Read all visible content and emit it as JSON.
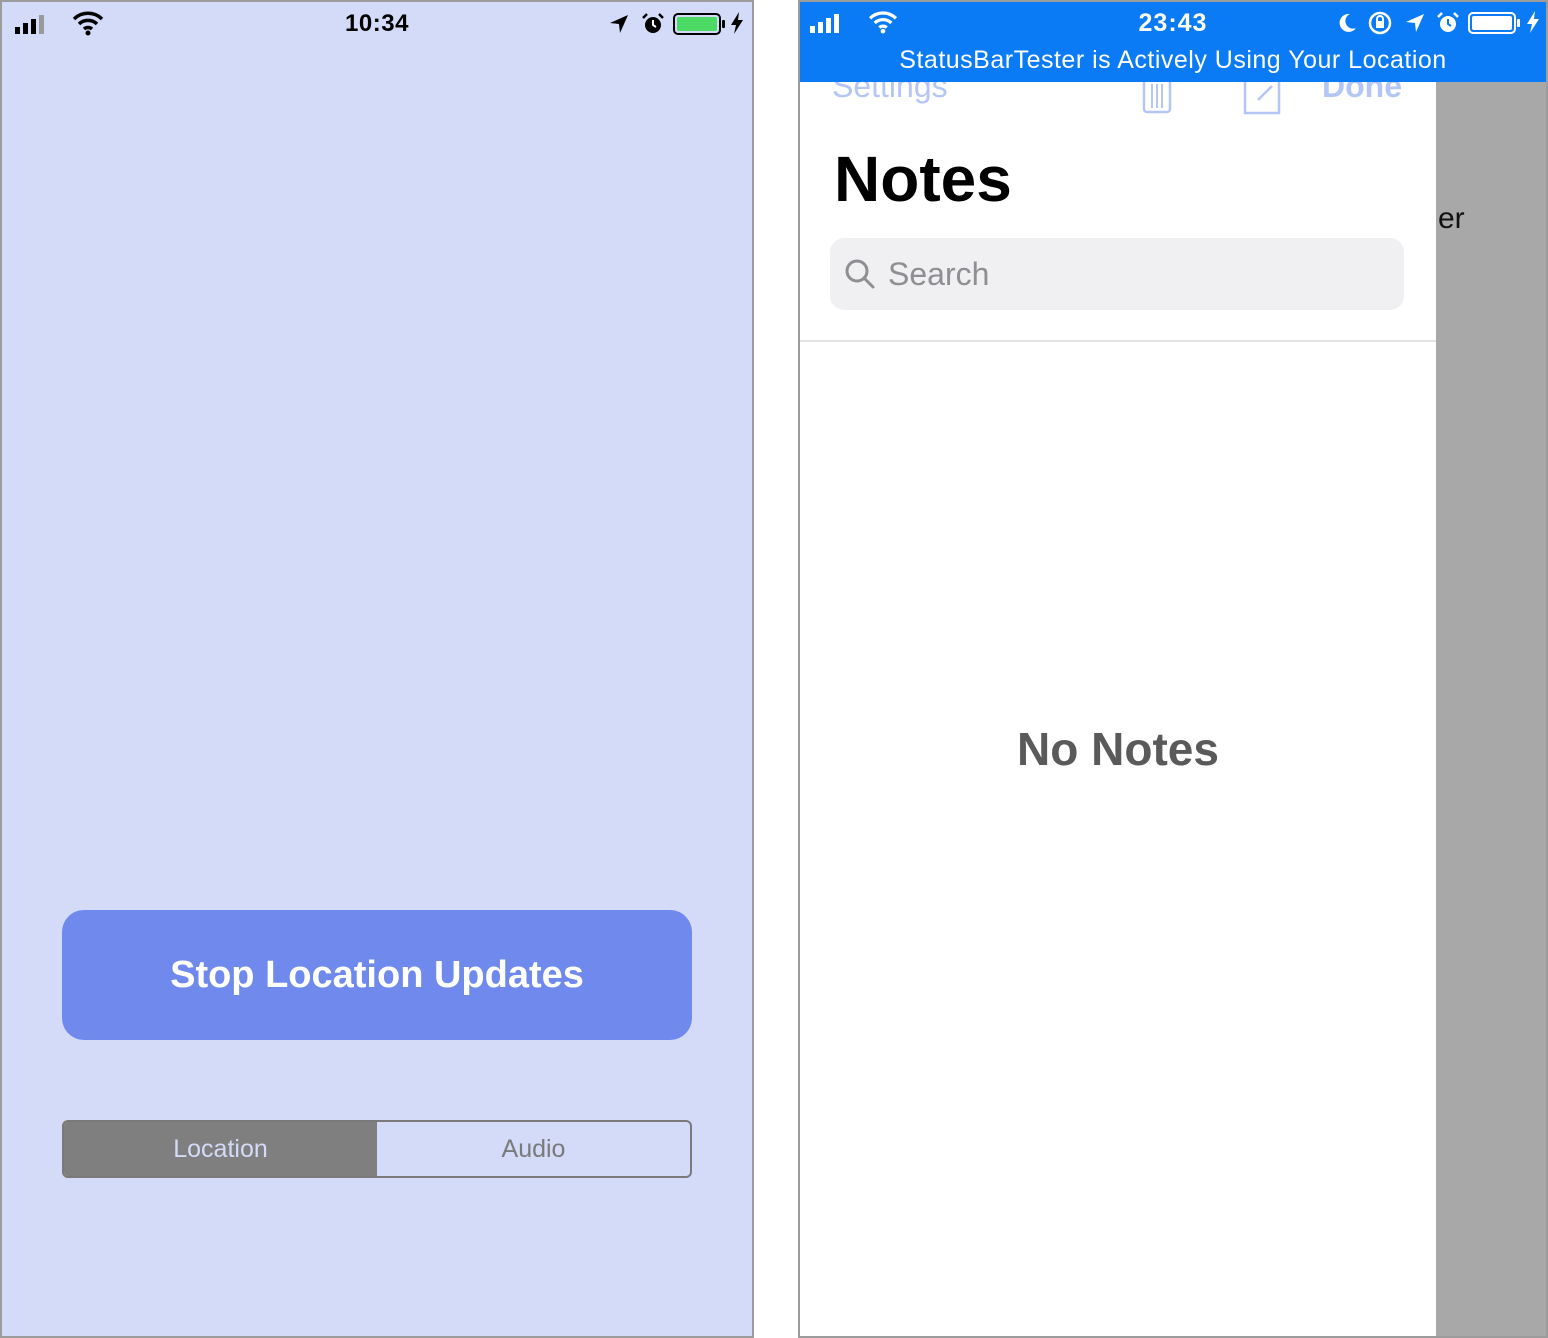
{
  "left_screen": {
    "status_bar": {
      "time": "10:34",
      "icons": [
        "signal-icon",
        "wifi-icon",
        "location-arrow-icon",
        "alarm-icon",
        "battery-icon",
        "charging-bolt-icon"
      ],
      "battery_color": "#4cd964"
    },
    "background_color": "#d3dbf9",
    "primary_button": {
      "label": "Stop Location Updates",
      "color": "#6f8aec"
    },
    "segmented_control": {
      "segments": [
        {
          "label": "Location",
          "selected": true
        },
        {
          "label": "Audio",
          "selected": false
        }
      ]
    }
  },
  "right_screen": {
    "status_bar": {
      "time": "23:43",
      "banner": "StatusBarTester is Actively Using Your Location",
      "color": "#0a7bf5",
      "icons": [
        "signal-icon",
        "wifi-icon",
        "moon-icon",
        "rotation-lock-icon",
        "location-arrow-icon",
        "alarm-icon",
        "battery-icon",
        "charging-bolt-icon"
      ]
    },
    "nav_bar": {
      "back_label": "Settings",
      "done_label": "Done",
      "icons": [
        "trash-icon",
        "compose-icon"
      ]
    },
    "title": "Notes",
    "search": {
      "placeholder": "Search"
    },
    "empty_state": "No Notes",
    "behind_text": "er"
  }
}
